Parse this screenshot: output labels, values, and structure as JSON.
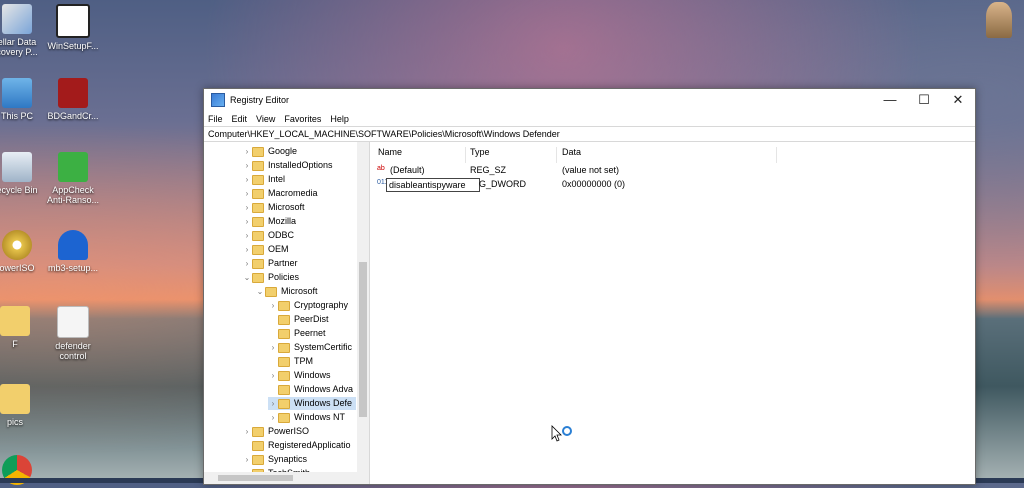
{
  "desktop": {
    "icons": [
      {
        "label": "ellar Data\ncovery P...",
        "icon": "recovery-icon"
      },
      {
        "label": "WinSetupF...",
        "icon": "winsetup-icon"
      },
      {
        "label": "This PC",
        "icon": "computer-icon"
      },
      {
        "label": "BDGandCr...",
        "icon": "bd-icon"
      },
      {
        "label": "ecycle Bin",
        "icon": "recycle-bin-icon"
      },
      {
        "label": "AppCheck\nAnti-Ranso...",
        "icon": "shield-check-icon"
      },
      {
        "label": "owerISO",
        "icon": "disc-icon"
      },
      {
        "label": "mb3-setup...",
        "icon": "malwarebytes-icon"
      },
      {
        "label": "F",
        "icon": "folder-icon"
      },
      {
        "label": "defender\ncontrol",
        "icon": "document-icon"
      },
      {
        "label": "pics",
        "icon": "folder-icon"
      }
    ]
  },
  "window": {
    "title": "Registry Editor",
    "controls": {
      "minimize": "—",
      "maximize": "☐",
      "close": "✕"
    },
    "menu": [
      "File",
      "Edit",
      "View",
      "Favorites",
      "Help"
    ],
    "address": "Computer\\HKEY_LOCAL_MACHINE\\SOFTWARE\\Policies\\Microsoft\\Windows Defender"
  },
  "tree": [
    {
      "label": "Google",
      "expander": "›",
      "level": 1
    },
    {
      "label": "InstalledOptions",
      "expander": "›",
      "level": 1
    },
    {
      "label": "Intel",
      "expander": "›",
      "level": 1
    },
    {
      "label": "Macromedia",
      "expander": "›",
      "level": 1
    },
    {
      "label": "Microsoft",
      "expander": "›",
      "level": 1
    },
    {
      "label": "Mozilla",
      "expander": "›",
      "level": 1
    },
    {
      "label": "ODBC",
      "expander": "›",
      "level": 1
    },
    {
      "label": "OEM",
      "expander": "›",
      "level": 1
    },
    {
      "label": "Partner",
      "expander": "›",
      "level": 1
    },
    {
      "label": "Policies",
      "expander": "⌄",
      "level": 1
    },
    {
      "label": "Microsoft",
      "expander": "⌄",
      "level": 2
    },
    {
      "label": "Cryptography",
      "expander": "›",
      "level": 3
    },
    {
      "label": "PeerDist",
      "expander": "",
      "level": 3
    },
    {
      "label": "Peernet",
      "expander": "",
      "level": 3
    },
    {
      "label": "SystemCertific",
      "expander": "›",
      "level": 3
    },
    {
      "label": "TPM",
      "expander": "",
      "level": 3
    },
    {
      "label": "Windows",
      "expander": "›",
      "level": 3
    },
    {
      "label": "Windows Adva",
      "expander": "",
      "level": 3
    },
    {
      "label": "Windows Defe",
      "expander": "›",
      "level": 3,
      "selected": true
    },
    {
      "label": "Windows NT",
      "expander": "›",
      "level": 3
    },
    {
      "label": "PowerISO",
      "expander": "›",
      "level": 1
    },
    {
      "label": "RegisteredApplicatio",
      "expander": "",
      "level": 1
    },
    {
      "label": "Synaptics",
      "expander": "›",
      "level": 1
    },
    {
      "label": "TechSmith",
      "expander": "›",
      "level": 1
    }
  ],
  "list": {
    "columns": [
      "Name",
      "Type",
      "Data"
    ],
    "rows": [
      {
        "name": "(Default)",
        "type": "REG_SZ",
        "data": "(value not set)",
        "icon": "ab"
      },
      {
        "name": "disableantispyware",
        "type": "G_DWORD",
        "data": "0x00000000 (0)",
        "icon": "011",
        "editing": true
      }
    ]
  }
}
